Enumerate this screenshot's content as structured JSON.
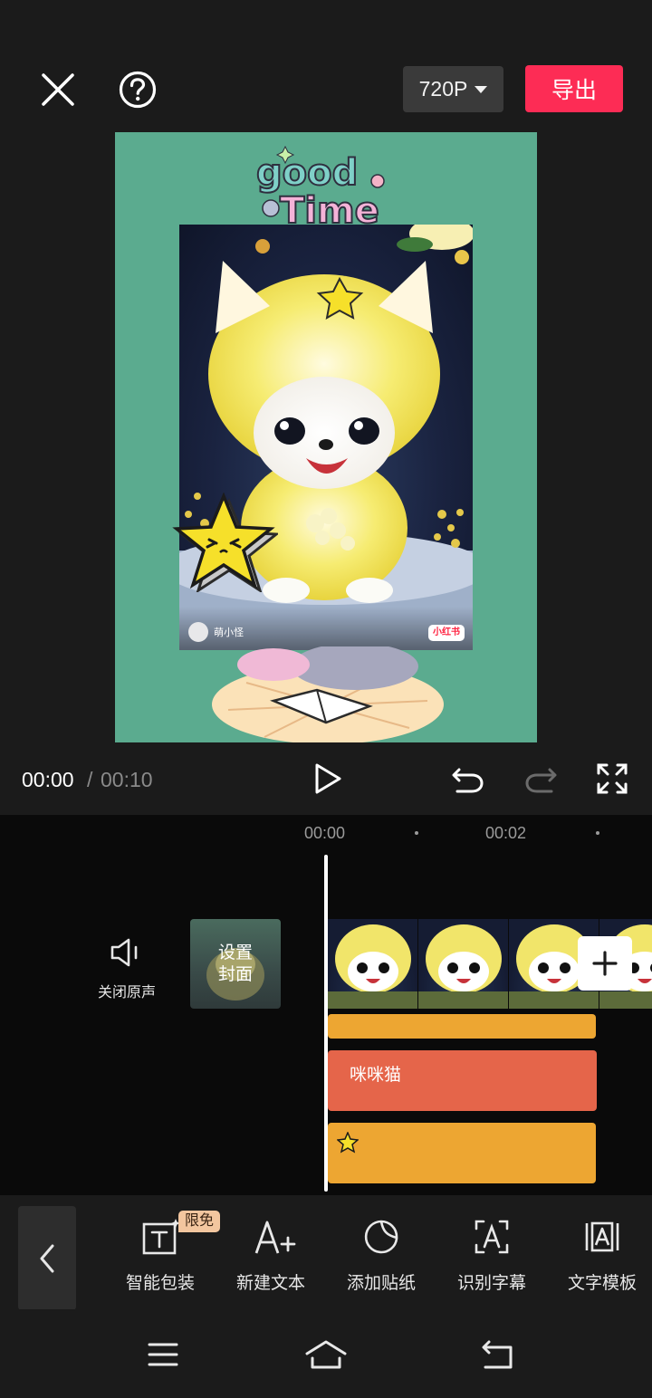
{
  "top_bar": {
    "close_icon": "close-icon",
    "help_icon": "help-icon",
    "resolution": "720P",
    "export_label": "导出"
  },
  "preview": {
    "sticker_text_line1": "good",
    "sticker_text_line2": "Time",
    "author_name": "萌小怪",
    "platform_badge": "小红书"
  },
  "playback": {
    "current_time": "00:00",
    "separator": "/",
    "total_time": "00:10"
  },
  "timeline": {
    "ruler": [
      "00:00",
      "00:02"
    ],
    "mute_label": "关闭原声",
    "cover_label_line1": "设置",
    "cover_label_line2": "封面",
    "text_clip_label": "咪咪猫"
  },
  "toolbar": {
    "badge": "限免",
    "tools": [
      {
        "label": "智能包装",
        "icon": "smart-package-icon"
      },
      {
        "label": "新建文本",
        "icon": "new-text-icon"
      },
      {
        "label": "添加贴纸",
        "icon": "sticker-icon"
      },
      {
        "label": "识别字幕",
        "icon": "recognize-subtitle-icon"
      },
      {
        "label": "文字模板",
        "icon": "text-template-icon"
      }
    ]
  },
  "colors": {
    "export": "#fd2c55",
    "canvas_bg": "#5bab8f",
    "audio_track": "#eda632",
    "text_track": "#e5654a",
    "badge": "#f3c69f"
  }
}
